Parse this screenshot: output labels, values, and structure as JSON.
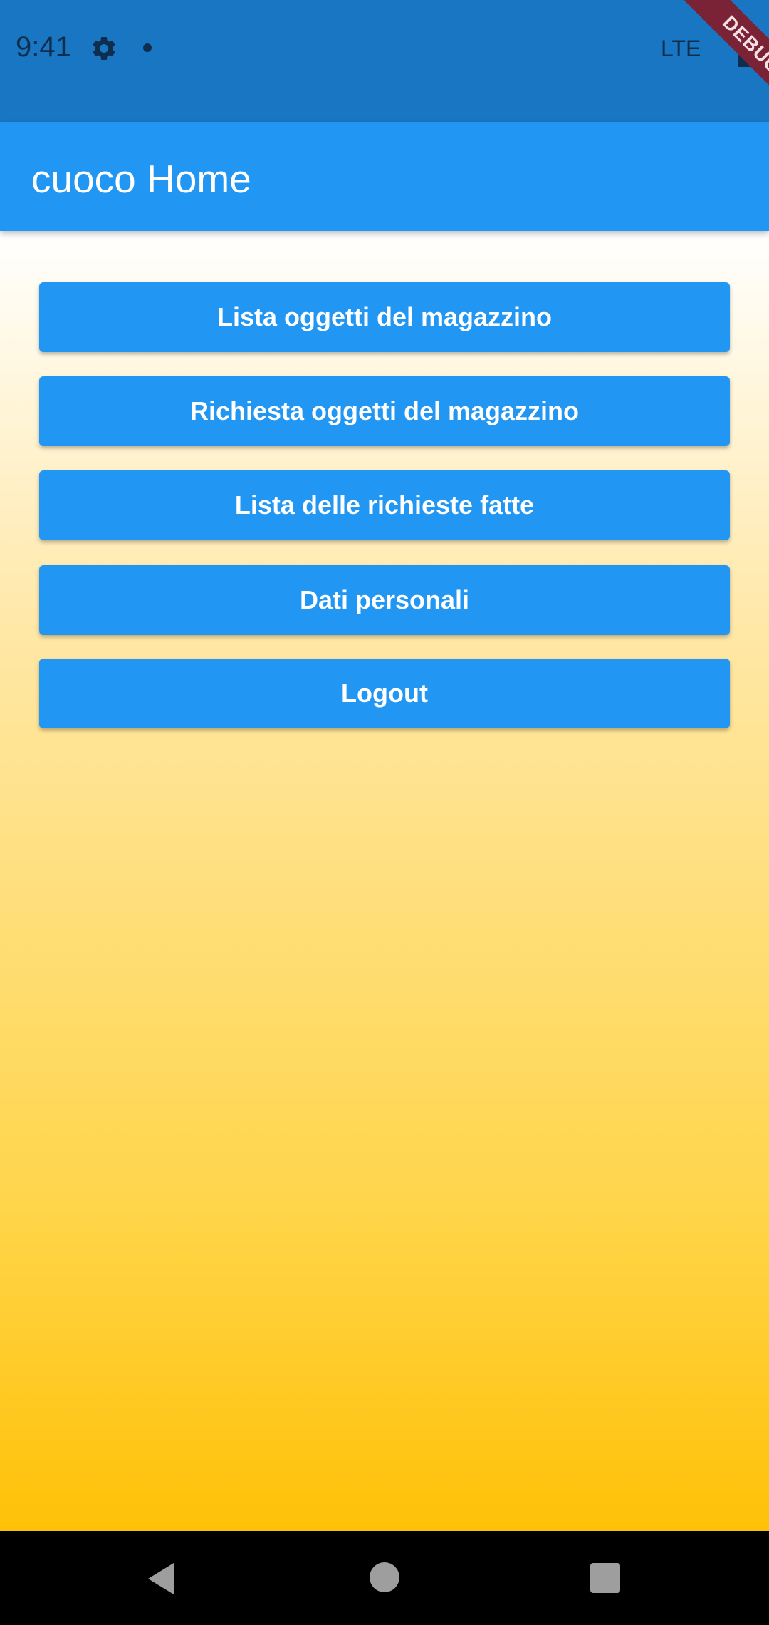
{
  "status_bar": {
    "time": "9:41",
    "network": "LTE",
    "icons": [
      "gear-icon",
      "notification-dot-icon",
      "battery-icon"
    ]
  },
  "debug_banner": {
    "label": "DEBUG"
  },
  "app_bar": {
    "title": "cuoco Home"
  },
  "menu": {
    "buttons": [
      {
        "label": "Lista oggetti del magazzino"
      },
      {
        "label": "Richiesta oggetti del magazzino"
      },
      {
        "label": "Lista delle richieste fatte"
      },
      {
        "label": "Dati personali"
      },
      {
        "label": "Logout"
      }
    ]
  },
  "nav_bar": {
    "icons": [
      "back-icon",
      "home-icon",
      "recent-apps-icon"
    ]
  },
  "colors": {
    "status_bar": "#1976C2",
    "app_bar": "#2196F3",
    "button": "#2196F3",
    "gradient_top": "#FFFFFF",
    "gradient_bottom": "#FFC107",
    "debug_banner": "#7A2336"
  }
}
